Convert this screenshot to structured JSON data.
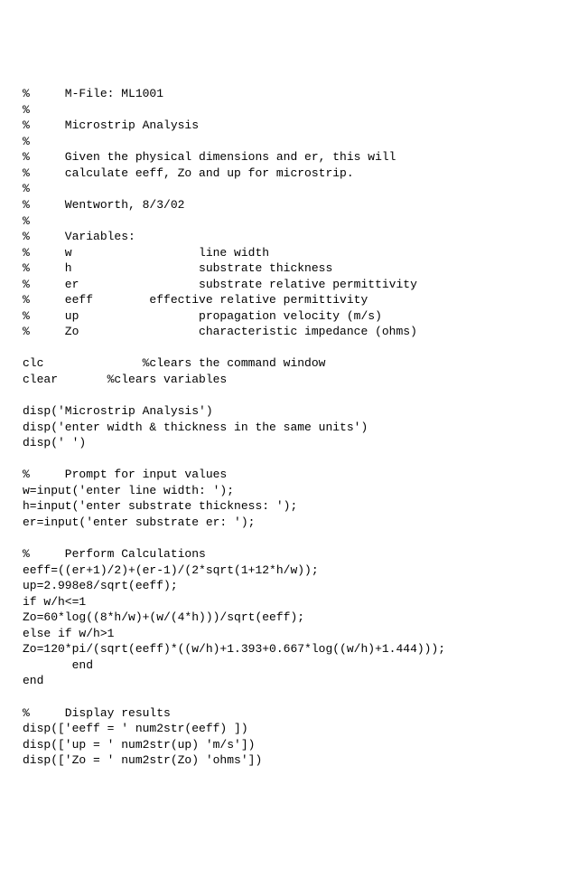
{
  "lines": [
    "%     M-File: ML1001",
    "%",
    "%     Microstrip Analysis",
    "%",
    "%     Given the physical dimensions and er, this will",
    "%     calculate eeff, Zo and up for microstrip.",
    "%",
    "%     Wentworth, 8/3/02",
    "%",
    "%     Variables:",
    "%     w                  line width",
    "%     h                  substrate thickness",
    "%     er                 substrate relative permittivity",
    "%     eeff        effective relative permittivity",
    "%     up                 propagation velocity (m/s)",
    "%     Zo                 characteristic impedance (ohms)",
    "",
    "clc              %clears the command window",
    "clear       %clears variables",
    "",
    "disp('Microstrip Analysis')",
    "disp('enter width & thickness in the same units')",
    "disp(' ')",
    "",
    "%     Prompt for input values",
    "w=input('enter line width: ');",
    "h=input('enter substrate thickness: ');",
    "er=input('enter substrate er: ');",
    "",
    "%     Perform Calculations",
    "eeff=((er+1)/2)+(er-1)/(2*sqrt(1+12*h/w));",
    "up=2.998e8/sqrt(eeff);",
    "if w/h<=1",
    "Zo=60*log((8*h/w)+(w/(4*h)))/sqrt(eeff);",
    "else if w/h>1",
    "Zo=120*pi/(sqrt(eeff)*((w/h)+1.393+0.667*log((w/h)+1.444)));",
    "       end",
    "end",
    "",
    "%     Display results",
    "disp(['eeff = ' num2str(eeff) ])",
    "disp(['up = ' num2str(up) 'm/s'])",
    "disp(['Zo = ' num2str(Zo) 'ohms'])"
  ]
}
